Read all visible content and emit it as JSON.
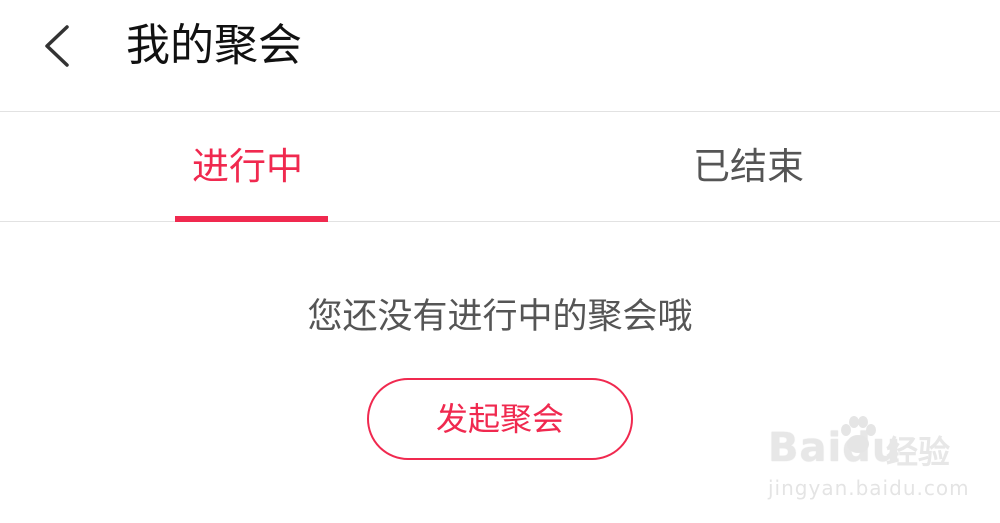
{
  "header": {
    "title": "我的聚会"
  },
  "tabs": [
    {
      "label": "进行中",
      "active": true
    },
    {
      "label": "已结束",
      "active": false
    }
  ],
  "empty_state": {
    "message": "您还没有进行中的聚会哦",
    "action_label": "发起聚会"
  },
  "watermark": {
    "logo_text": "Baidu",
    "brand_text": "经验",
    "url_text": "jingyan.baidu.com"
  },
  "colors": {
    "accent": "#f0294f",
    "title_text": "#111111",
    "secondary_text": "#555555",
    "divider": "#e2e2e2",
    "background": "#ffffff"
  },
  "icons": {
    "back": "chevron-left-icon",
    "watermark_paw": "paw-icon"
  }
}
